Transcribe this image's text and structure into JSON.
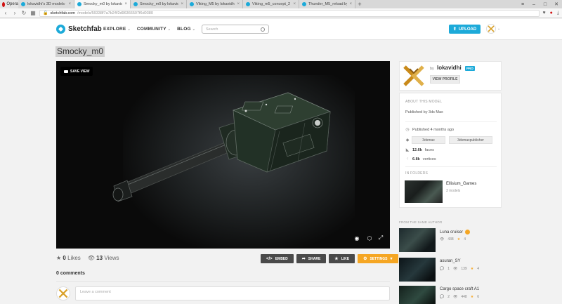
{
  "browser": {
    "opera_label": "Opera",
    "tabs": [
      {
        "title": "lokavidhi's 3D models - S",
        "active": false
      },
      {
        "title": "Smocky_m0 by lokavidhi - S",
        "active": true
      },
      {
        "title": "Smocky_m0 by lokavidhi - S",
        "active": false
      },
      {
        "title": "Viking_M5 by lokavidhi - S",
        "active": false
      },
      {
        "title": "Viking_m5_concept_2 by",
        "active": false
      },
      {
        "title": "Thunder_M5_reload by lo",
        "active": false
      }
    ],
    "url_host": "sketchfab.com",
    "url_path": "/models/59338f7a7b24f2d96366507f6d0380"
  },
  "header": {
    "brand": "Sketchfab",
    "menu": [
      {
        "label": "EXPLORE"
      },
      {
        "label": "COMMUNITY"
      },
      {
        "label": "BLOG"
      }
    ],
    "search_placeholder": "Search",
    "upload_label": "UPLOAD"
  },
  "model": {
    "title": "Smocky_m0",
    "save_view_label": "SAVE VIEW",
    "likes_count": "0",
    "likes_label": "Likes",
    "views_count": "13",
    "views_label": "Views",
    "actions": {
      "embed": "EMBED",
      "share": "SHARE",
      "like": "LIKE",
      "settings": "SETTINGS"
    }
  },
  "comments": {
    "heading": "0 comments",
    "placeholder": "Leave a comment"
  },
  "author": {
    "by": "by",
    "name": "lokavidhi",
    "pro_badge": "PRO",
    "view_profile": "VIEW PROFILE"
  },
  "info": {
    "about_heading": "ABOUT THIS MODEL",
    "published_with": "Published by 3ds Max",
    "published_ago": "Published 4 months ago",
    "tags": [
      "3dsmax",
      "3dsmaxpublisher"
    ],
    "faces_value": "12.6k",
    "faces_label": "faces",
    "vertices_value": "6.8k",
    "vertices_label": "vertices",
    "folders_heading": "IN FOLDERS",
    "folder_name": "Ellisium_Games",
    "folder_count": "3 models"
  },
  "more_from_author": {
    "heading": "FROM THE SAME AUTHOR",
    "items": [
      {
        "name": "Luna cruiser",
        "comments": "",
        "views": "438",
        "likes": "4",
        "badge": true
      },
      {
        "name": "asuran_SY",
        "comments": "1",
        "views": "139",
        "likes": "4",
        "badge": false
      },
      {
        "name": "Cargo space craft A1",
        "comments": "2",
        "views": "448",
        "likes": "6",
        "badge": false
      }
    ]
  },
  "colors": {
    "accent": "#1caad9",
    "settings": "#f5a623",
    "action_dark": "#4a4a4a"
  }
}
